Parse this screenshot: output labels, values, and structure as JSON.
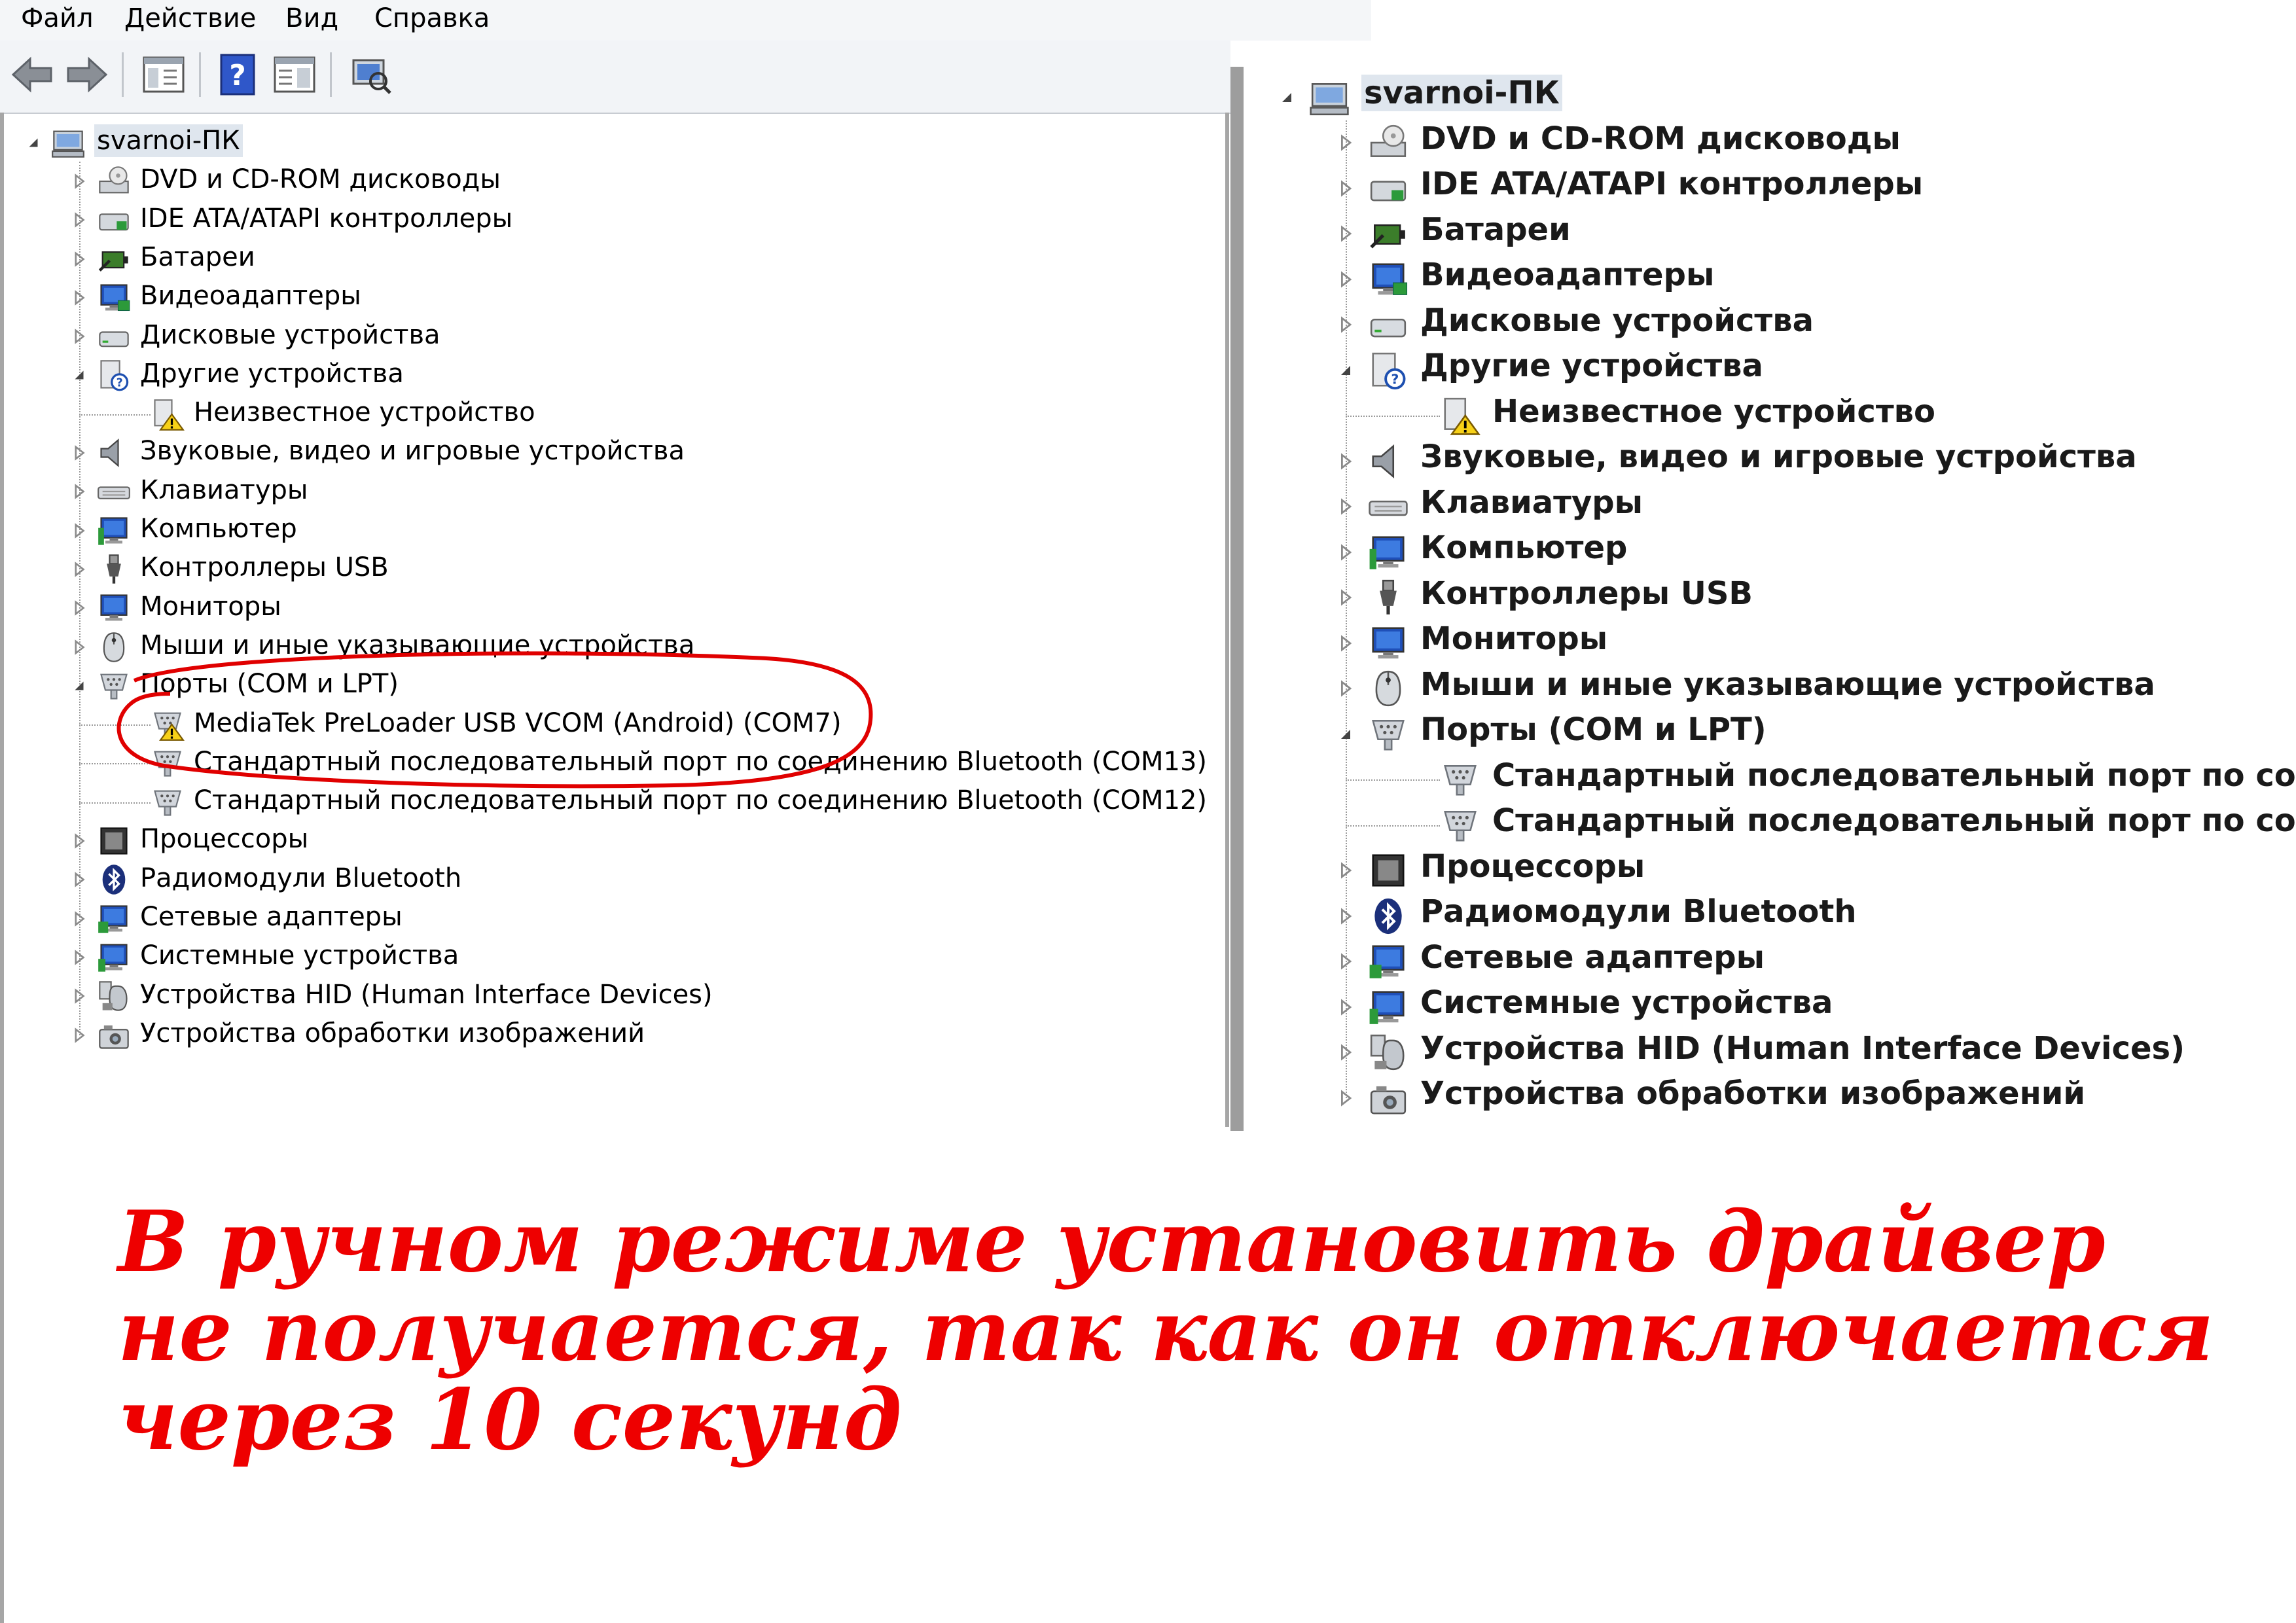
{
  "menu": [
    "Файл",
    "Действие",
    "Вид",
    "Справка"
  ],
  "toolbar": {
    "icons": [
      "back-arrow-icon",
      "forward-arrow-icon",
      "console-tree-icon",
      "help-icon",
      "properties-icon",
      "scan-hardware-icon"
    ]
  },
  "left_tree": {
    "root": "svarnoi-ПК",
    "items": [
      {
        "label": "DVD и CD-ROM дисководы",
        "icon": "dvd-drive-icon",
        "expander": "collapsed"
      },
      {
        "label": "IDE ATA/ATAPI контроллеры",
        "icon": "ide-controller-icon",
        "expander": "collapsed"
      },
      {
        "label": "Батареи",
        "icon": "battery-icon",
        "expander": "collapsed"
      },
      {
        "label": "Видеоадаптеры",
        "icon": "display-adapter-icon",
        "expander": "collapsed"
      },
      {
        "label": "Дисковые устройства",
        "icon": "disk-drive-icon",
        "expander": "collapsed"
      },
      {
        "label": "Другие устройства",
        "icon": "other-devices-icon",
        "expander": "expanded",
        "children": [
          {
            "label": "Неизвестное устройство",
            "icon": "unknown-device-warning-icon"
          }
        ]
      },
      {
        "label": "Звуковые, видео и игровые устройства",
        "icon": "speaker-icon",
        "expander": "collapsed"
      },
      {
        "label": "Клавиатуры",
        "icon": "keyboard-icon",
        "expander": "collapsed"
      },
      {
        "label": "Компьютер",
        "icon": "computer-icon",
        "expander": "collapsed"
      },
      {
        "label": "Контроллеры USB",
        "icon": "usb-plug-icon",
        "expander": "collapsed"
      },
      {
        "label": "Мониторы",
        "icon": "monitor-icon",
        "expander": "collapsed"
      },
      {
        "label": "Мыши и иные указывающие устройства",
        "icon": "mouse-icon",
        "expander": "collapsed"
      },
      {
        "label": "Порты (COM и LPT)",
        "icon": "port-icon",
        "expander": "expanded",
        "children": [
          {
            "label": "MediaTek PreLoader USB VCOM (Android) (COM7)",
            "icon": "port-warning-icon"
          },
          {
            "label": "Стандартный последовательный порт по соединению Bluetooth (COM13)",
            "icon": "port-icon"
          },
          {
            "label": "Стандартный последовательный порт по соединению Bluetooth (COM12)",
            "icon": "port-icon"
          }
        ]
      },
      {
        "label": "Процессоры",
        "icon": "processor-icon",
        "expander": "collapsed"
      },
      {
        "label": "Радиомодули Bluetooth",
        "icon": "bluetooth-icon",
        "expander": "collapsed"
      },
      {
        "label": "Сетевые адаптеры",
        "icon": "network-adapter-icon",
        "expander": "collapsed"
      },
      {
        "label": "Системные устройства",
        "icon": "system-devices-icon",
        "expander": "collapsed"
      },
      {
        "label": "Устройства HID (Human Interface Devices)",
        "icon": "hid-icon",
        "expander": "collapsed"
      },
      {
        "label": "Устройства обработки изображений",
        "icon": "imaging-device-icon",
        "expander": "collapsed"
      }
    ]
  },
  "right_tree": {
    "root": "svarnoi-ПК",
    "items": [
      {
        "label": "DVD и CD-ROM дисководы",
        "icon": "dvd-drive-icon",
        "expander": "collapsed"
      },
      {
        "label": "IDE ATA/ATAPI контроллеры",
        "icon": "ide-controller-icon",
        "expander": "collapsed"
      },
      {
        "label": "Батареи",
        "icon": "battery-icon",
        "expander": "collapsed"
      },
      {
        "label": "Видеоадаптеры",
        "icon": "display-adapter-icon",
        "expander": "collapsed"
      },
      {
        "label": "Дисковые устройства",
        "icon": "disk-drive-icon",
        "expander": "collapsed"
      },
      {
        "label": "Другие устройства",
        "icon": "other-devices-icon",
        "expander": "expanded",
        "children": [
          {
            "label": "Неизвестное устройство",
            "icon": "unknown-device-warning-icon"
          }
        ]
      },
      {
        "label": "Звуковые, видео и игровые устройства",
        "icon": "speaker-icon",
        "expander": "collapsed"
      },
      {
        "label": "Клавиатуры",
        "icon": "keyboard-icon",
        "expander": "collapsed"
      },
      {
        "label": "Компьютер",
        "icon": "computer-icon",
        "expander": "collapsed"
      },
      {
        "label": "Контроллеры USB",
        "icon": "usb-plug-icon",
        "expander": "collapsed"
      },
      {
        "label": "Мониторы",
        "icon": "monitor-icon",
        "expander": "collapsed"
      },
      {
        "label": "Мыши и иные указывающие устройства",
        "icon": "mouse-icon",
        "expander": "collapsed"
      },
      {
        "label": "Порты (COM и LPT)",
        "icon": "port-icon",
        "expander": "expanded",
        "children": [
          {
            "label": "Стандартный последовательный порт по сое",
            "icon": "port-icon"
          },
          {
            "label": "Стандартный последовательный порт по сое",
            "icon": "port-icon"
          }
        ]
      },
      {
        "label": "Процессоры",
        "icon": "processor-icon",
        "expander": "collapsed"
      },
      {
        "label": "Радиомодули Bluetooth",
        "icon": "bluetooth-icon",
        "expander": "collapsed"
      },
      {
        "label": "Сетевые адаптеры",
        "icon": "network-adapter-icon",
        "expander": "collapsed"
      },
      {
        "label": "Системные устройства",
        "icon": "system-devices-icon",
        "expander": "collapsed"
      },
      {
        "label": "Устройства HID (Human Interface Devices)",
        "icon": "hid-icon",
        "expander": "collapsed"
      },
      {
        "label": "Устройства обработки изображений",
        "icon": "imaging-device-icon",
        "expander": "collapsed"
      }
    ]
  },
  "annotation": {
    "highlight_color": "#e00000",
    "caption": [
      "В ручном режиме установить драйвер",
      "не получается, так как он отключается",
      "через 10 секунд"
    ]
  }
}
